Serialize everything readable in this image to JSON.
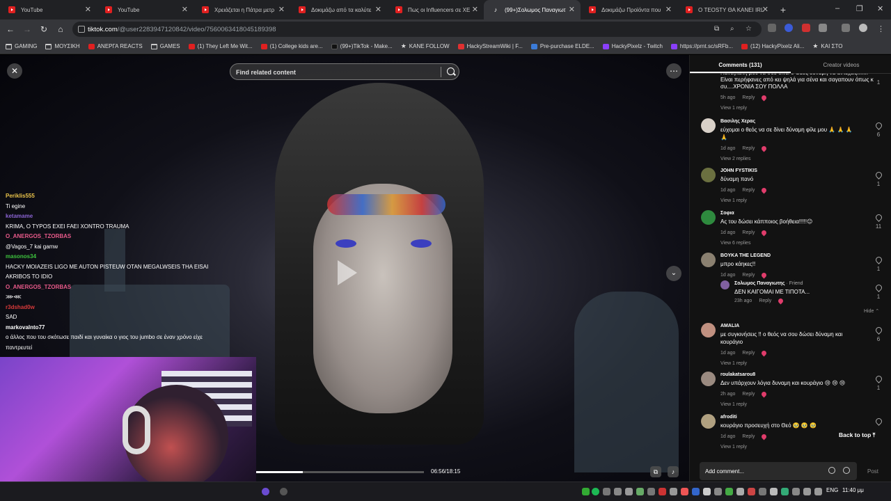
{
  "browser": {
    "tabs": [
      {
        "label": "YouTube",
        "icon": "youtube-icon",
        "active": false
      },
      {
        "label": "YouTube",
        "icon": "youtube-icon",
        "active": false
      },
      {
        "label": "Χρειάζεται η Πάτρα μετρ",
        "icon": "youtube-icon",
        "active": false
      },
      {
        "label": "Δοκιμάζω από τα καλύτε",
        "icon": "youtube-icon",
        "active": false
      },
      {
        "label": "Πως οι Influencers σε ΧΕ",
        "icon": "youtube-icon",
        "active": false
      },
      {
        "label": "(99+)Σολωμος Παναγιωτ",
        "icon": "tiktok-icon",
        "active": true
      },
      {
        "label": "Δοκιμάζω Προϊόντα που",
        "icon": "youtube-icon",
        "active": false
      },
      {
        "label": "Ο TEOSTY ΘΑ ΚΑΝΕΙ IRL",
        "icon": "youtube-icon",
        "active": false
      }
    ],
    "url_host": "tiktok.com",
    "url_path": "/@user2283947120842/video/7560063418045189398",
    "bookmarks": [
      {
        "label": "GAMING",
        "icon": "folder"
      },
      {
        "label": "ΜΟΥΣΙΚΗ",
        "icon": "folder"
      },
      {
        "label": "ΑΝΕΡΓΑ REACTS",
        "icon": "yt"
      },
      {
        "label": "GAMES",
        "icon": "folder"
      },
      {
        "label": "(1) They Left Me Wit...",
        "icon": "yt"
      },
      {
        "label": "(1) College kids are...",
        "icon": "yt"
      },
      {
        "label": "(99+)TikTok - Make...",
        "icon": "tt"
      },
      {
        "label": "ΚΑΝΕ FOLLOW",
        "icon": "star"
      },
      {
        "label": "HackyStreamWiki | F...",
        "icon": "red"
      },
      {
        "label": "Pre-purchase ELDE...",
        "icon": "blue"
      },
      {
        "label": "HackyPixelz - Twitch",
        "icon": "purple"
      },
      {
        "label": "https://prnt.sc/sRFb...",
        "icon": "purple"
      },
      {
        "label": "(12) HackyPixelz Ali...",
        "icon": "yt"
      },
      {
        "label": "ΚΑΙ ΣΤΟ",
        "icon": "star"
      }
    ]
  },
  "video": {
    "search_placeholder": "Find related content",
    "time": "06:56/18:15",
    "progress": 0.28
  },
  "chat": [
    {
      "user": "Periklis555",
      "color": "#e8c24a",
      "text": "Ti egine"
    },
    {
      "user": "ketamame",
      "color": "#8a63d2",
      "text": "KRIMA, O TYPOS EXEI FAEI XONTRO TRAUMA"
    },
    {
      "user": "O_ANERGOS_TZORBAS",
      "color": "#e85a8a",
      "text": "@Vagos_7 kai gamw"
    },
    {
      "user": "masonos34",
      "color": "#3ec43e",
      "text": "HACKY MOIAZEIS LIGO ME AUTON PISTEUW OTAN MEGALWSEIS THA EISAI AKRIBOS TO IDIO"
    },
    {
      "user": "O_ANERGOS_TZORBAS",
      "color": "#e85a8a",
      "text": "⋙⋘"
    },
    {
      "user": "r3dshad0w",
      "color": "#d83a3a",
      "text": "SAD"
    },
    {
      "user": "markovalnto77",
      "color": "#ffffff",
      "text": "ο άλλος που του σκότωσε παιδί και γυναίκα ο γιος του jumbo σε έναν χρόνο είχε παντρευτεί"
    }
  ],
  "panel": {
    "tab_comments": "Comments (131)",
    "tab_creator": "Creator videos",
    "top_partial": {
      "text": "Παναγιώτη μου να σου δίνει ο Θεός δύναμη να αντέχεις...!!!! Είναι περήφανες από κει ψηλά για σένα και σαγαπουν όπως κ συ....ΧΡΟΝΙΑ ΣΟΥ ΠΟΛΛΑ",
      "time": "5h ago",
      "reply": "Reply",
      "likes": "1",
      "replies": "View 1 reply"
    },
    "comments": [
      {
        "name": "Βασιλης Χερας",
        "text": "εύχομαι ο θεός να σε δίνει δύναμη φίλε μου 🙏 🙏 🙏 🙏",
        "time": "1d ago",
        "reply": "Reply",
        "likes": "6",
        "replies": "View 2 replies",
        "avatar": "#d8d0c8"
      },
      {
        "name": "JOHN FYSTIKIS",
        "text": "δύναμη πανό",
        "time": "1d ago",
        "reply": "Reply",
        "likes": "1",
        "replies": "View 1 reply",
        "avatar": "#6b7040"
      },
      {
        "name": "Σοφια",
        "text": "Ας του δώσει κάπποιος βοήθεια!!!!!😐",
        "time": "1d ago",
        "reply": "Reply",
        "likes": "11",
        "replies": "View 6 replies",
        "avatar": "#2e8a3e"
      },
      {
        "name": "BOYKA THE LEGEND",
        "text": "μπρο κάηκες!!",
        "time": "1d ago",
        "reply": "Reply",
        "likes": "1",
        "replies": "",
        "avatar": "#8a8070"
      },
      {
        "name": "AMALIA",
        "text": "με συγκινήσεις !! ο θεός να σου δώσει δύναμη και κουράγιο",
        "time": "1d ago",
        "reply": "Reply",
        "likes": "6",
        "replies": "View 1 reply",
        "avatar": "#c09080"
      },
      {
        "name": "roulakatsarou8",
        "text": "Δεν υπάρχουν λόγια δυναμη και κουράγιο 😢 😢 😢",
        "time": "2h ago",
        "reply": "Reply",
        "likes": "1",
        "replies": "View 1 reply",
        "avatar": "#9a8a80"
      },
      {
        "name": "afroditi",
        "text": "κουράγιο προσευχή στο Θεό 🥹 🥹 🥹",
        "time": "1d ago",
        "reply": "Reply",
        "likes": "",
        "replies": "View 1 reply",
        "avatar": "#b0a080"
      }
    ],
    "nested": {
      "name": "Σολωμος Παναγιωτης",
      "badge": "· Friend",
      "text": "ΔΕΝ ΚΑΙΓΟΜΑΙ ΜΕ ΤΙΠΟΤΑ...",
      "time": "23h ago",
      "reply": "Reply",
      "likes": "1",
      "hide": "Hide"
    },
    "back_to_top": "Back to top",
    "add_comment": "Add comment...",
    "post": "Post"
  },
  "taskbar": {
    "lang": "ENG",
    "clock": "11:40 μμ"
  }
}
